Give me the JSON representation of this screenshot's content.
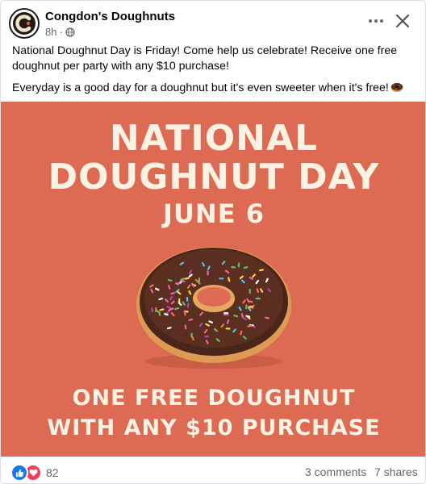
{
  "post": {
    "page_name": "Congdon's Doughnuts",
    "time_ago": "8h",
    "separator": "·",
    "privacy_icon": "globe-icon",
    "more_icon": "more-horizontal-icon",
    "close_icon": "close-icon",
    "text_paragraph_1": "National Doughnut Day is Friday! Come help us celebrate! Receive one free doughnut per party with any $10 purchase!",
    "text_paragraph_2": "Everyday is a good day for a doughnut but it's even sweeter when it's free!",
    "text_emoji": "doughnut-emoji-icon"
  },
  "image": {
    "line_1": "NATIONAL",
    "line_2": "DOUGHNUT DAY",
    "line_3": "JUNE 6",
    "line_4": "ONE FREE DOUGHNUT",
    "line_5": "WITH ANY $10 PURCHASE",
    "background_color": "#dd6b53",
    "text_color": "#fbf2e3"
  },
  "footer": {
    "reaction_icons": [
      "like-icon",
      "love-icon"
    ],
    "reaction_count": "82",
    "comments": "3 comments",
    "shares": "7 shares"
  }
}
